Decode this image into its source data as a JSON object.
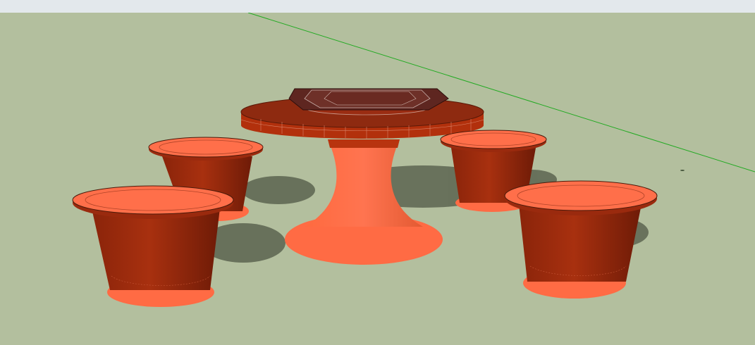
{
  "app": {
    "toolbar_strip": "",
    "scene_description_visible": ""
  },
  "colors": {
    "ground": "#b3bf9e",
    "toolbar": "#e3e8ec",
    "axis_green": "#22aa22",
    "wood_dark": "#7a1f0a",
    "wood_mid": "#a8300f",
    "wood_light": "#ff6a40",
    "top_face": "#ff6f4a",
    "shadow": "#5c6450",
    "table_top": "#8e2a10",
    "hex_panel": "#6b2a22"
  },
  "icons": {
    "axis": "green-axis-line"
  }
}
